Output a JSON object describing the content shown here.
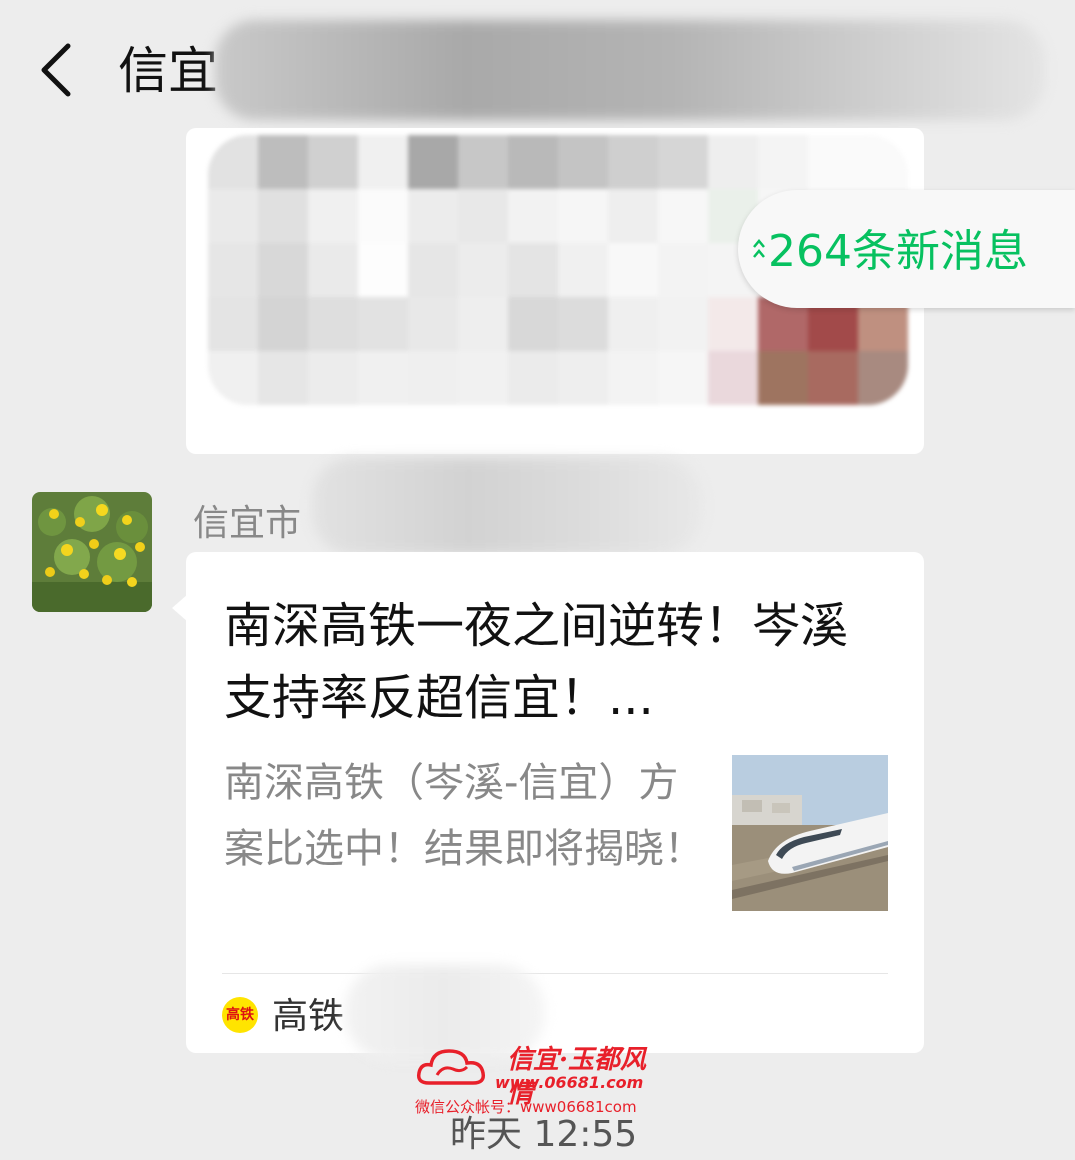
{
  "header": {
    "title": "信宜"
  },
  "new_messages": {
    "label": "264条新消息"
  },
  "message": {
    "sender_visible": "信宜市",
    "card": {
      "title": "南深高铁一夜之间逆转！岑溪支持率反超信宜！...",
      "description": "南深高铁（岑溪-信宜）方案比选中！结果即将揭晓！",
      "source_icon_text": "高铁",
      "source_name": "高铁"
    }
  },
  "timestamp": "昨天 12:55",
  "watermark": {
    "title": "信宜·玉都风情",
    "url": "www.06681.com",
    "subtitle": "微信公众帐号：www06681com"
  },
  "colors": {
    "accent_green": "#07c160",
    "background": "#ededed",
    "watermark_red": "#e8202a"
  }
}
